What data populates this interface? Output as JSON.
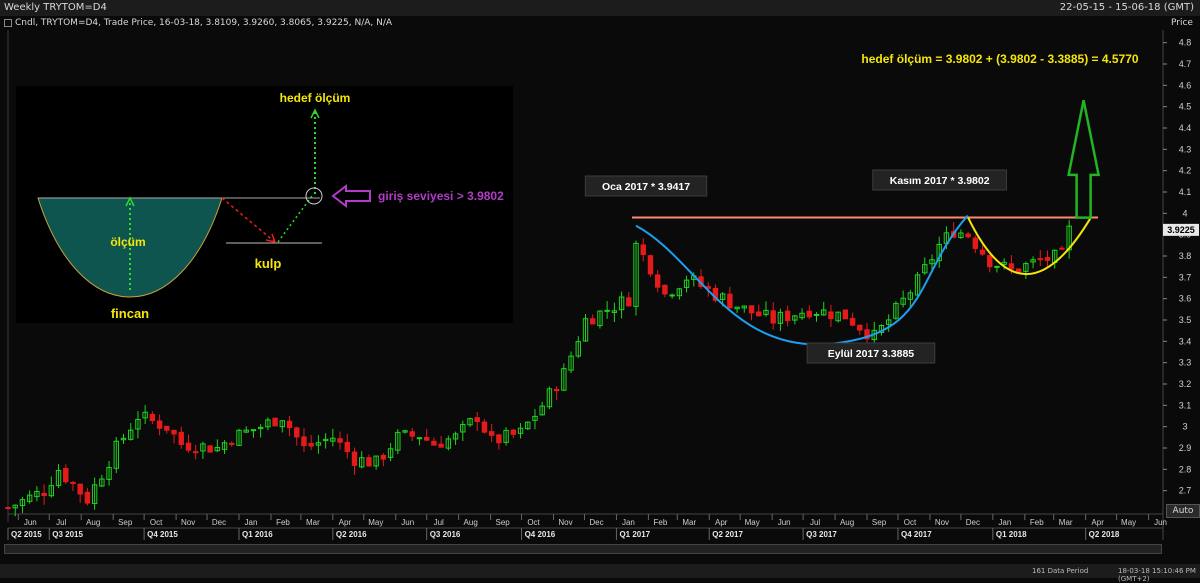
{
  "window": {
    "title": "Weekly TRYTOM=D4",
    "date_range": "22-05-15 - 15-06-18 (GMT)",
    "info_line": "Cndl, TRYTOM=D4, Trade Price, 16-03-18, 3.8109, 3.9260, 3.8065, 3.9225, N/A, N/A",
    "price_axis_header": "Price",
    "auto_button": "Auto",
    "status_points": "161 Data Period",
    "status_time": "18-03-18 15:10:46 PM (GMT+2)"
  },
  "colors": {
    "up": "#1fd31f",
    "down": "#e51b1b",
    "cup_curve": "#1e9ef0",
    "handle_curve": "#f5e60a",
    "resistance": "#ff8a70",
    "target_text": "#f5e60a",
    "arrow": "#22b422",
    "entry_text": "#b23cc8"
  },
  "annotations": {
    "target_formula": "hedef ölçüm = 3.9802 + (3.9802 - 3.3885) = 4.5770",
    "label_jan": "Oca 2017 * 3.9417",
    "label_nov": "Kasım 2017 * 3.9802",
    "label_sep": "Eylül 2017  3.3885"
  },
  "inset": {
    "target": "hedef ölçüm",
    "measure": "ölçüm",
    "cup": "fincan",
    "handle": "kulp",
    "entry": "giriş seviyesi > 3.9802"
  },
  "chart_data": {
    "type": "candlestick",
    "title": "Weekly TRYTOM=D4",
    "ylim": [
      2.6,
      4.85
    ],
    "yticks": [
      2.7,
      2.8,
      2.9,
      3.0,
      3.1,
      3.2,
      3.3,
      3.4,
      3.5,
      3.6,
      3.7,
      3.8,
      3.9,
      4.0,
      4.1,
      4.2,
      4.3,
      4.4,
      4.5,
      4.6,
      4.7,
      4.8
    ],
    "last_price": 3.9225,
    "x_start_date": "2015-05-22",
    "x_end_date": "2018-06-15",
    "month_labels": [
      "Jun",
      "Jul",
      "Aug",
      "Sep",
      "Oct",
      "Nov",
      "Dec",
      "Jan",
      "Feb",
      "Mar",
      "Apr",
      "May",
      "Jun",
      "Jul",
      "Aug",
      "Sep",
      "Oct",
      "Nov",
      "Dec",
      "Jan",
      "Feb",
      "Mar",
      "Apr",
      "May",
      "Jun",
      "Jul",
      "Aug",
      "Sep",
      "Oct",
      "Nov",
      "Dec",
      "Jan",
      "Feb",
      "Mar",
      "Apr",
      "May",
      "Jun"
    ],
    "quarter_labels": [
      "Q2 2015",
      "Q3 2015",
      "Q4 2015",
      "Q1 2016",
      "Q2 2016",
      "Q3 2016",
      "Q4 2016",
      "Q1 2017",
      "Q2 2017",
      "Q3 2017",
      "Q4 2017",
      "Q1 2018",
      "Q2 2018"
    ],
    "resistance": 3.9802,
    "cup_low": 3.3885,
    "jan_high": 3.9417,
    "target": 4.577,
    "series": [
      {
        "name": "TRYTOM=D4",
        "anchors": [
          [
            "2015-05-22",
            2.62
          ],
          [
            "2015-06-26",
            2.7
          ],
          [
            "2015-07-10",
            2.8
          ],
          [
            "2015-08-07",
            2.66
          ],
          [
            "2015-09-04",
            2.9
          ],
          [
            "2015-09-25",
            3.05
          ],
          [
            "2015-10-23",
            3.0
          ],
          [
            "2015-11-06",
            2.92
          ],
          [
            "2015-12-11",
            2.9
          ],
          [
            "2015-12-25",
            2.95
          ],
          [
            "2016-01-22",
            3.0
          ],
          [
            "2016-02-12",
            3.05
          ],
          [
            "2016-03-04",
            2.9
          ],
          [
            "2016-04-01",
            2.95
          ],
          [
            "2016-04-22",
            2.85
          ],
          [
            "2016-05-13",
            2.83
          ],
          [
            "2016-06-03",
            2.95
          ],
          [
            "2016-06-24",
            2.96
          ],
          [
            "2016-07-08",
            2.92
          ],
          [
            "2016-07-29",
            2.95
          ],
          [
            "2016-08-19",
            3.05
          ],
          [
            "2016-09-02",
            2.93
          ],
          [
            "2016-09-30",
            2.97
          ],
          [
            "2016-10-21",
            3.1
          ],
          [
            "2016-11-11",
            3.25
          ],
          [
            "2016-12-02",
            3.5
          ],
          [
            "2016-12-23",
            3.55
          ],
          [
            "2017-01-13",
            3.6
          ],
          [
            "2017-01-20",
            3.85
          ],
          [
            "2017-02-03",
            3.75
          ],
          [
            "2017-02-17",
            3.62
          ],
          [
            "2017-03-10",
            3.7
          ],
          [
            "2017-04-07",
            3.62
          ],
          [
            "2017-05-05",
            3.55
          ],
          [
            "2017-06-02",
            3.5
          ],
          [
            "2017-07-07",
            3.55
          ],
          [
            "2017-08-11",
            3.52
          ],
          [
            "2017-09-08",
            3.42
          ],
          [
            "2017-09-22",
            3.5
          ],
          [
            "2017-10-20",
            3.68
          ],
          [
            "2017-11-10",
            3.85
          ],
          [
            "2017-11-24",
            3.92
          ],
          [
            "2017-12-08",
            3.9
          ],
          [
            "2017-12-29",
            3.78
          ],
          [
            "2018-01-19",
            3.73
          ],
          [
            "2018-02-16",
            3.78
          ],
          [
            "2018-03-09",
            3.8
          ],
          [
            "2018-03-16",
            3.92
          ]
        ]
      }
    ]
  }
}
